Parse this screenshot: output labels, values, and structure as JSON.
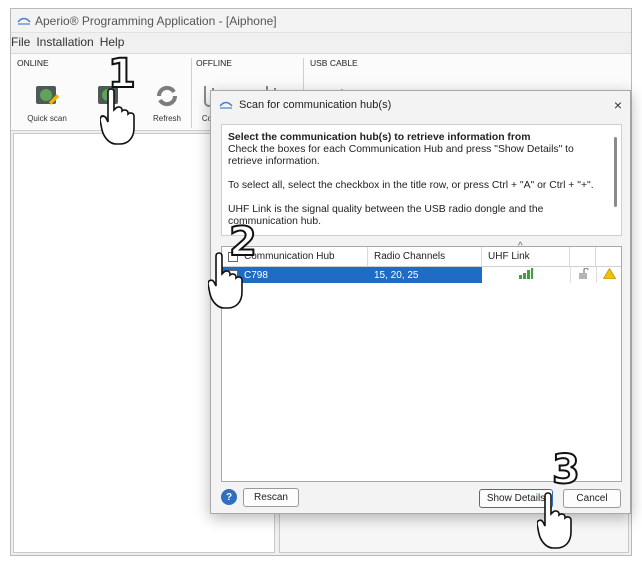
{
  "window": {
    "title": "Aperio® Programming Application - [Aiphone]"
  },
  "menu": [
    "File",
    "Installation",
    "Help"
  ],
  "toolbar": {
    "online_label": "ONLINE",
    "offline_label": "OFFLINE",
    "usb_label": "USB CABLE",
    "quick_scan": "Quick scan",
    "scan": "Scan",
    "refresh": "Refresh",
    "offline_btn": "Co"
  },
  "dialog": {
    "title": "Scan for communication hub(s)",
    "close": "×",
    "info_title": "Select the communication hub(s) to retrieve information from",
    "info_line1": "Check the boxes for each Communication Hub and press \"Show Details\" to retrieve information.",
    "info_line2": "To select all, select the checkbox in the title row, or press Ctrl + \"A\" or Ctrl + \"+\".",
    "info_line3": "UHF Link is the signal quality between the USB radio dongle and the communication hub.",
    "columns": [
      "Communication Hub",
      "Radio Channels",
      "UHF Link"
    ],
    "rows": [
      {
        "hub": "C798",
        "channels": "15, 20, 25",
        "uhf": "strong"
      }
    ],
    "rescan": "Rescan",
    "show_details": "Show Details",
    "cancel": "Cancel",
    "help": "?"
  },
  "steps": [
    "1",
    "2",
    "3"
  ],
  "colors": {
    "accent": "#1f6cc4",
    "signal": "#3aa33a",
    "warning": "#f2c100"
  }
}
